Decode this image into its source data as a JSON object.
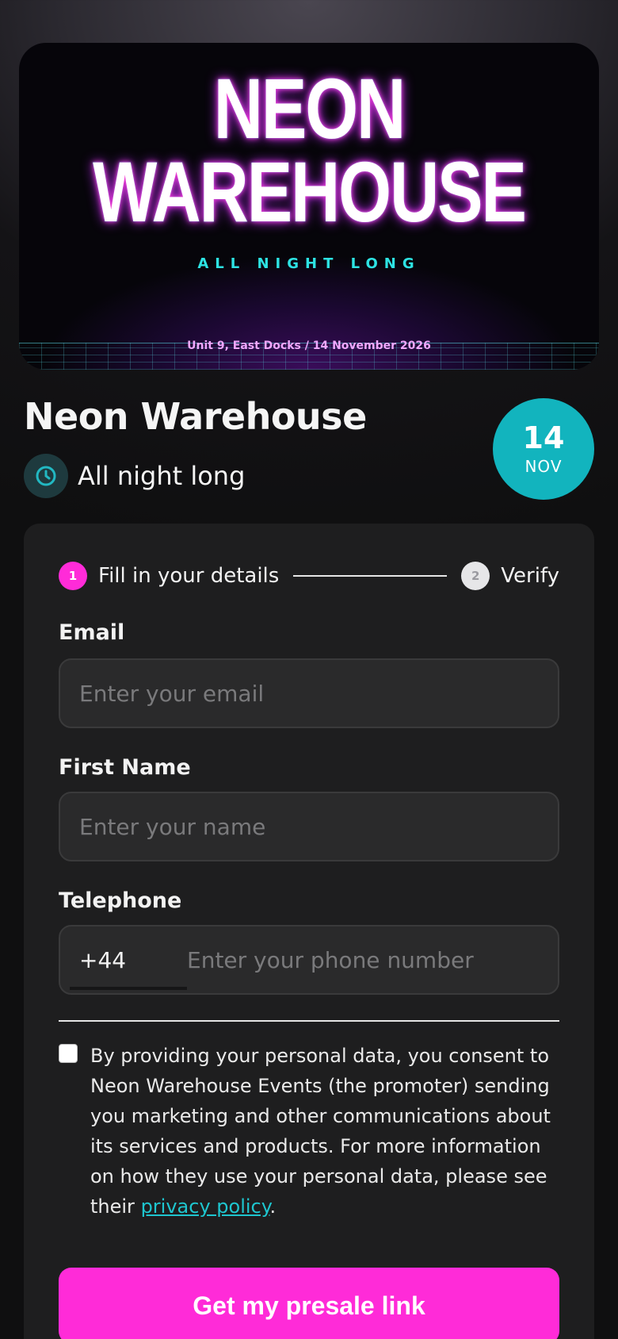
{
  "hero": {
    "title_line1": "NEON",
    "title_line2": "WAREHOUSE",
    "tagline": "ALL NIGHT LONG",
    "venue_date": "Unit 9, East Docks / 14 November 2026"
  },
  "event": {
    "name": "Neon Warehouse",
    "time": "All night long",
    "date_day": "14",
    "date_month": "NOV"
  },
  "steps": [
    {
      "number": "1",
      "label": "Fill in your details"
    },
    {
      "number": "2",
      "label": "Verify"
    }
  ],
  "form": {
    "email_label": "Email",
    "email_placeholder": "Enter your email",
    "name_label": "First Name",
    "name_placeholder": "Enter your name",
    "phone_label": "Telephone",
    "phone_country_code": "+44",
    "phone_placeholder": "Enter your phone number"
  },
  "consent": {
    "text_before": "By providing your personal data, you consent to Neon Warehouse Events (the promoter) sending you marketing and other communications about its services and products. For more information on how they use your personal data, please see their ",
    "link_text": "privacy policy",
    "text_after": "."
  },
  "cta_label": "Get my presale link",
  "colors": {
    "accent": "#ff2bd8",
    "teal": "#12b4be",
    "link": "#1ec6cf",
    "card": "#1e1e1f"
  }
}
